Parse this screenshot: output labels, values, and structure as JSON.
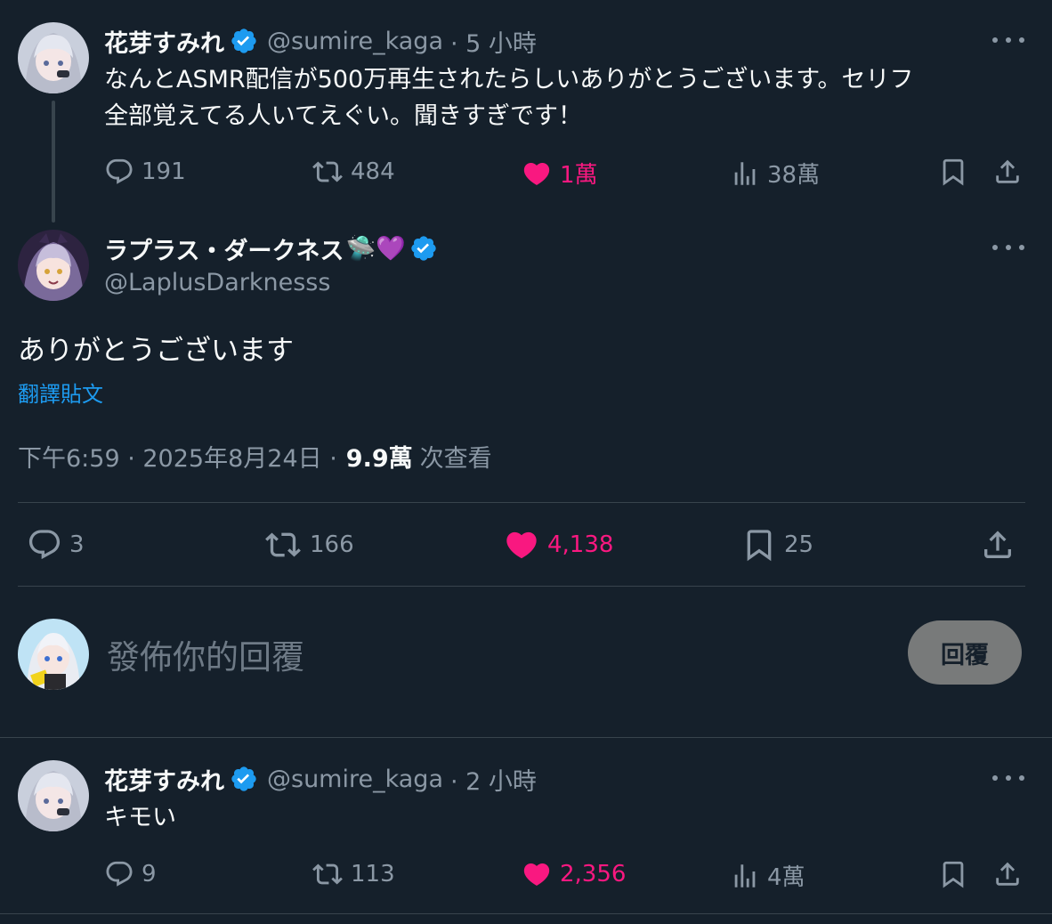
{
  "tweet1": {
    "name": "花芽すみれ",
    "handle": "@sumire_kaga",
    "time": "· 5 小時",
    "text_line1": "なんとASMR配信が500万再生されたらしいありがとうございます。セリフ",
    "text_line2": "全部覚えてる人いてえぐい。聞きすぎです！",
    "replies": "191",
    "retweets": "484",
    "likes": "1萬",
    "views": "38萬"
  },
  "main_tweet": {
    "name": "ラプラス・ダークネス",
    "name_emoji": "🛸💜",
    "handle": "@LaplusDarknesss",
    "text": "ありがとうございます",
    "translate": "翻譯貼文",
    "time": "下午6:59 · 2025年8月24日 ·",
    "views_count": "9.9萬",
    "views_label": "次查看",
    "replies": "3",
    "retweets": "166",
    "likes": "4,138",
    "bookmarks": "25"
  },
  "composer": {
    "placeholder": "發佈你的回覆",
    "reply_button": "回覆"
  },
  "tweet3": {
    "name": "花芽すみれ",
    "handle": "@sumire_kaga",
    "time": "· 2 小時",
    "text": "キモい",
    "replies": "9",
    "retweets": "113",
    "likes": "2,356",
    "views": "4萬"
  },
  "colors": {
    "background": "#15202b",
    "muted": "#8b98a5",
    "like": "#f91880",
    "link": "#1d9bf0",
    "verified": "#1d9bf0",
    "divider": "#38444d"
  },
  "icons": [
    "reply-icon",
    "retweet-icon",
    "like-icon",
    "views-icon",
    "bookmark-icon",
    "share-icon",
    "more-icon",
    "verified-icon"
  ]
}
